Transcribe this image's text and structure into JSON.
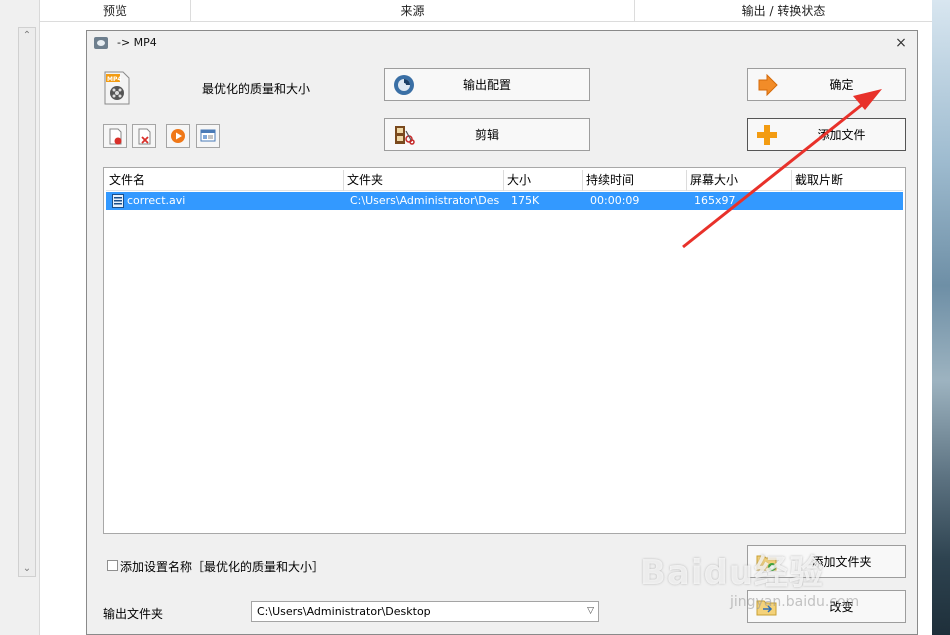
{
  "background": {
    "columns": [
      "预览",
      "来源",
      "输出 / 转换状态"
    ]
  },
  "dialog": {
    "title": "-> MP4",
    "close_glyph": "×",
    "quality_label": "最优化的质量和大小",
    "buttons": {
      "output_config": "输出配置",
      "edit": "剪辑",
      "ok": "确定",
      "add_file": "添加文件",
      "add_folder": "添加文件夹",
      "change": "改变"
    },
    "toolbar_icons": [
      "remove-file-icon",
      "clear-list-icon",
      "play-icon",
      "media-info-icon"
    ],
    "file_list": {
      "columns": [
        "文件名",
        "文件夹",
        "大小",
        "持续时间",
        "屏幕大小",
        "截取片断"
      ],
      "rows": [
        {
          "name": "correct.avi",
          "folder": "C:\\Users\\Administrator\\Des...",
          "size": "175K",
          "duration": "00:00:09",
          "screen": "165x97",
          "clip": ""
        }
      ]
    },
    "save_setting_label": "添加设置名称［最优化的质量和大小］",
    "output_folder_label": "输出文件夹",
    "output_folder_value": "C:\\Users\\Administrator\\Desktop",
    "dropdown_caret": "▽"
  },
  "watermark": {
    "main": "Baidu经验",
    "sub": "jingyan.baidu.com"
  },
  "colors": {
    "selection": "#3399ff",
    "annotation_arrow": "#e8312a",
    "add_orange": "#f39c12"
  }
}
